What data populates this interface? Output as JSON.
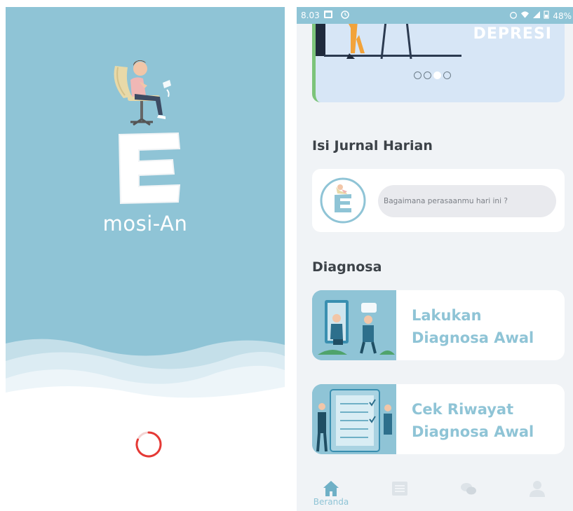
{
  "splash": {
    "app_name": "mosi-An",
    "logo_letter": "E"
  },
  "home": {
    "statusbar": {
      "time": "8.03",
      "battery": "48%"
    },
    "banner": {
      "title": "DEPRESI",
      "slide_count": 4,
      "active_slide": 2
    },
    "journal": {
      "title": "Isi Jurnal Harian",
      "input_placeholder": "Bagaimana perasaanmu hari ini ?"
    },
    "diagnosa": {
      "title": "Diagnosa",
      "cards": [
        {
          "label": "Lakukan Diagnosa Awal"
        },
        {
          "label": "Cek Riwayat Diagnosa Awal"
        }
      ]
    },
    "bottom_nav": {
      "items": [
        {
          "label": "Beranda",
          "icon": "home-icon",
          "active": true
        },
        {
          "label": "",
          "icon": "journal-list-icon",
          "active": false
        },
        {
          "label": "",
          "icon": "chat-icon",
          "active": false
        },
        {
          "label": "",
          "icon": "profile-icon",
          "active": false
        }
      ]
    }
  },
  "colors": {
    "brand": "#8fc4d6",
    "brand_dark": "#6fb0c6",
    "text_dark": "#3c4248",
    "background": "#f0f3f6",
    "spinner": "#e53935"
  }
}
